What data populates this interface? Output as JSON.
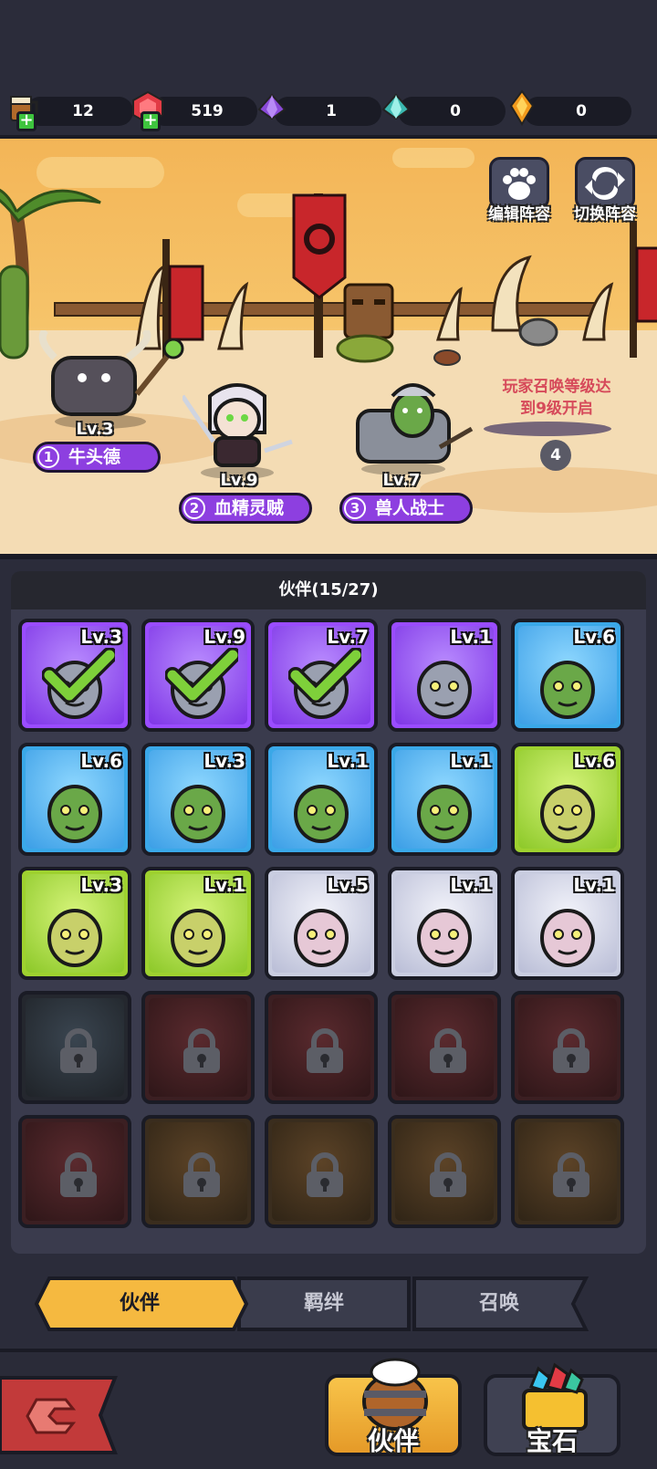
{
  "resources": [
    {
      "icon": "beer-mug-icon",
      "value": "12",
      "plus": true
    },
    {
      "icon": "red-gem-icon",
      "value": "519",
      "plus": true
    },
    {
      "icon": "purple-crystal-icon",
      "value": "1",
      "plus": false
    },
    {
      "icon": "teal-crystal-icon",
      "value": "0",
      "plus": false
    },
    {
      "icon": "orange-gem-icon",
      "value": "0",
      "plus": false
    }
  ],
  "scene": {
    "edit_lineup_label": "编辑阵容",
    "switch_lineup_label": "切换阵容",
    "heroes": [
      {
        "slot": "1",
        "name": "牛头德",
        "level": "Lv.3"
      },
      {
        "slot": "2",
        "name": "血精灵贼",
        "level": "Lv.9"
      },
      {
        "slot": "3",
        "name": "兽人战士",
        "level": "Lv.7"
      }
    ],
    "locked_slot": {
      "text_line1": "玩家召唤等级达",
      "text_line2": "到9级开启",
      "slot": "4"
    }
  },
  "panel": {
    "title": "伙伴(15/27)",
    "cards": [
      {
        "rarity": "purple",
        "level": "Lv.3",
        "selected": true,
        "portrait": "tauren-druid-portrait"
      },
      {
        "rarity": "purple",
        "level": "Lv.9",
        "selected": true,
        "portrait": "blood-elf-rogue-portrait"
      },
      {
        "rarity": "purple",
        "level": "Lv.7",
        "selected": true,
        "portrait": "orc-warrior-portrait"
      },
      {
        "rarity": "purple",
        "level": "Lv.1",
        "selected": false,
        "portrait": "undead-mage-portrait"
      },
      {
        "rarity": "blue",
        "level": "Lv.6",
        "selected": false,
        "portrait": "troll-portrait"
      },
      {
        "rarity": "blue",
        "level": "Lv.6",
        "selected": false,
        "portrait": "orc-shaman-portrait"
      },
      {
        "rarity": "blue",
        "level": "Lv.3",
        "selected": false,
        "portrait": "tauren-portrait"
      },
      {
        "rarity": "blue",
        "level": "Lv.1",
        "selected": false,
        "portrait": "night-elf-priestess-portrait"
      },
      {
        "rarity": "blue",
        "level": "Lv.1",
        "selected": false,
        "portrait": "undead-girl-portrait"
      },
      {
        "rarity": "green",
        "level": "Lv.6",
        "selected": false,
        "portrait": "goblin-portrait"
      },
      {
        "rarity": "green",
        "level": "Lv.3",
        "selected": false,
        "portrait": "elf-paladin-portrait"
      },
      {
        "rarity": "green",
        "level": "Lv.1",
        "selected": false,
        "portrait": "undead-warrior-portrait"
      },
      {
        "rarity": "white",
        "level": "Lv.5",
        "selected": false,
        "portrait": "elf-mage-portrait"
      },
      {
        "rarity": "white",
        "level": "Lv.1",
        "selected": false,
        "portrait": "undead-rogue-portrait"
      },
      {
        "rarity": "white",
        "level": "Lv.1",
        "selected": false,
        "portrait": "troll-berserker-portrait"
      },
      {
        "rarity": "locked-dark",
        "level": "",
        "selected": false,
        "portrait": "locked"
      },
      {
        "rarity": "locked-red",
        "level": "",
        "selected": false,
        "portrait": "locked"
      },
      {
        "rarity": "locked-red",
        "level": "",
        "selected": false,
        "portrait": "locked"
      },
      {
        "rarity": "locked-red",
        "level": "",
        "selected": false,
        "portrait": "locked"
      },
      {
        "rarity": "locked-red",
        "level": "",
        "selected": false,
        "portrait": "locked"
      },
      {
        "rarity": "locked-red",
        "level": "",
        "selected": false,
        "portrait": "locked"
      },
      {
        "rarity": "locked-brown",
        "level": "",
        "selected": false,
        "portrait": "locked"
      },
      {
        "rarity": "locked-brown",
        "level": "",
        "selected": false,
        "portrait": "locked"
      },
      {
        "rarity": "locked-brown",
        "level": "",
        "selected": false,
        "portrait": "locked"
      },
      {
        "rarity": "locked-brown",
        "level": "",
        "selected": false,
        "portrait": "locked"
      }
    ]
  },
  "tabs": {
    "companion": "伙伴",
    "bond": "羁绊",
    "summon": "召唤",
    "active": "companion"
  },
  "bottom_nav": {
    "companion_label": "伙伴",
    "gem_label": "宝石"
  },
  "colors": {
    "active_tab": "#f5b940",
    "nameplate": "#8d3fe0",
    "unlock_text": "#d64a5a"
  }
}
